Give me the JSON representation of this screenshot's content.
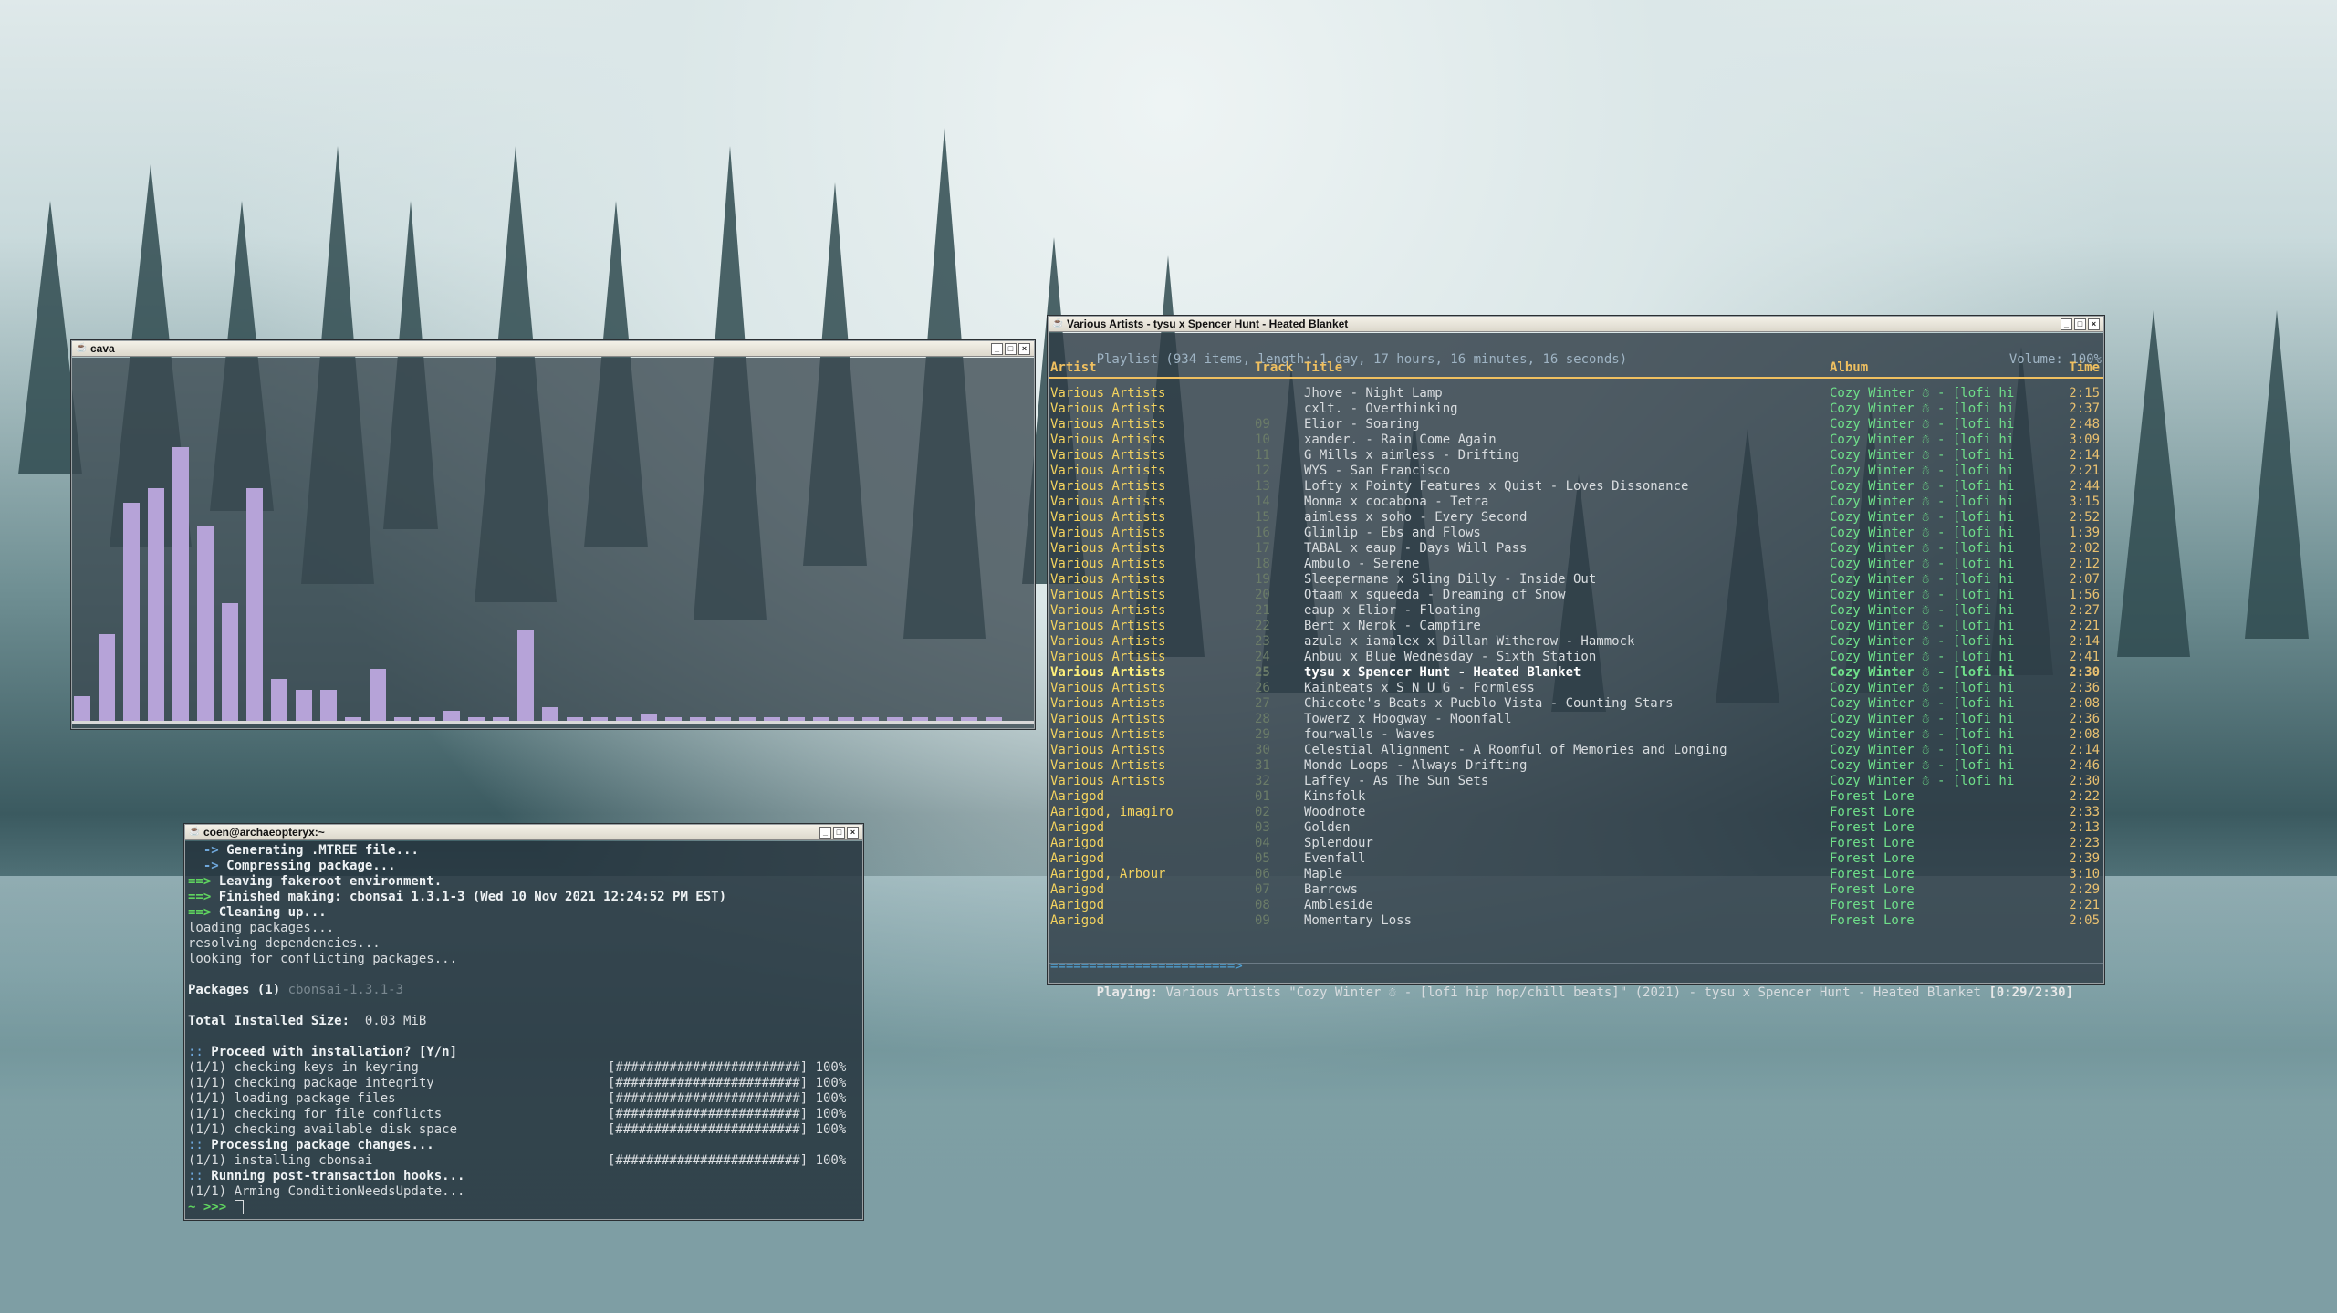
{
  "cava": {
    "title": "cava",
    "bar_levels": [
      0.07,
      0.25,
      0.63,
      0.67,
      0.79,
      0.56,
      0.34,
      0.67,
      0.12,
      0.09,
      0.09,
      0.01,
      0.15,
      0.01,
      0.01,
      0.03,
      0.01,
      0.01,
      0.26,
      0.04,
      0.01,
      0.01,
      0.01,
      0.02,
      0.01,
      0.01,
      0.01,
      0.01,
      0.01,
      0.01,
      0.01,
      0.01,
      0.01,
      0.01,
      0.01,
      0.01,
      0.01,
      0.01
    ],
    "bar_color": "#b6a3d8"
  },
  "terminal": {
    "title": "coen@archaeopteryx:~",
    "lines": [
      {
        "type": "arrow2",
        "text": "Generating .MTREE file..."
      },
      {
        "type": "arrow2",
        "text": "Compressing package..."
      },
      {
        "type": "green",
        "text": "Leaving fakeroot environment."
      },
      {
        "type": "green",
        "text": "Finished making: cbonsai 1.3.1-3 (Wed 10 Nov 2021 12:24:52 PM EST)"
      },
      {
        "type": "green",
        "text": "Cleaning up..."
      },
      {
        "type": "plain",
        "text": "loading packages..."
      },
      {
        "type": "plain",
        "text": "resolving dependencies..."
      },
      {
        "type": "plain",
        "text": "looking for conflicting packages..."
      },
      {
        "type": "blank",
        "text": ""
      },
      {
        "type": "pkgs",
        "text": "Packages (1) ",
        "extra": "cbonsai-1.3.1-3"
      },
      {
        "type": "blank",
        "text": ""
      },
      {
        "type": "size",
        "text": "Total Installed Size:  ",
        "extra": "0.03 MiB"
      },
      {
        "type": "blank",
        "text": ""
      },
      {
        "type": "colon",
        "text": "Proceed with installation? [Y/n]"
      },
      {
        "type": "progress",
        "text": "(1/1) checking keys in keyring",
        "bar": "[########################] 100%"
      },
      {
        "type": "progress",
        "text": "(1/1) checking package integrity",
        "bar": "[########################] 100%"
      },
      {
        "type": "progress",
        "text": "(1/1) loading package files",
        "bar": "[########################] 100%"
      },
      {
        "type": "progress",
        "text": "(1/1) checking for file conflicts",
        "bar": "[########################] 100%"
      },
      {
        "type": "progress",
        "text": "(1/1) checking available disk space",
        "bar": "[########################] 100%"
      },
      {
        "type": "colon",
        "text": "Processing package changes..."
      },
      {
        "type": "progress",
        "text": "(1/1) installing cbonsai",
        "bar": "[########################] 100%"
      },
      {
        "type": "colon",
        "text": "Running post-transaction hooks..."
      },
      {
        "type": "plain",
        "text": "(1/1) Arming ConditionNeedsUpdate..."
      },
      {
        "type": "prompt",
        "text": "~ >>> "
      }
    ]
  },
  "player": {
    "title": "Various Artists - tysu x Spencer Hunt - Heated Blanket",
    "playlist_info": "Playlist (934 items, length: 1 day, 17 hours, 16 minutes, 16 seconds)",
    "volume": "Volume: 100%",
    "columns": {
      "artist": "Artist",
      "track": "Track",
      "title": "Title",
      "album": "Album",
      "time": "Time"
    },
    "rows": [
      {
        "artist": "Various Artists",
        "track": "",
        "title": "Jhove - Night Lamp",
        "album": "Cozy Winter ☃ - [lofi hi",
        "time": "2:15"
      },
      {
        "artist": "Various Artists",
        "track": "",
        "title": "cxlt. - Overthinking",
        "album": "Cozy Winter ☃ - [lofi hi",
        "time": "2:37"
      },
      {
        "artist": "Various Artists",
        "track": "09",
        "title": "Elior - Soaring",
        "album": "Cozy Winter ☃ - [lofi hi",
        "time": "2:48"
      },
      {
        "artist": "Various Artists",
        "track": "10",
        "title": "xander. - Rain Come Again",
        "album": "Cozy Winter ☃ - [lofi hi",
        "time": "3:09"
      },
      {
        "artist": "Various Artists",
        "track": "11",
        "title": "G Mills x aimless - Drifting",
        "album": "Cozy Winter ☃ - [lofi hi",
        "time": "2:14"
      },
      {
        "artist": "Various Artists",
        "track": "12",
        "title": "WYS - San Francisco",
        "album": "Cozy Winter ☃ - [lofi hi",
        "time": "2:21"
      },
      {
        "artist": "Various Artists",
        "track": "13",
        "title": "Lofty x Pointy Features x Quist - Loves Dissonance",
        "album": "Cozy Winter ☃ - [lofi hi",
        "time": "2:44"
      },
      {
        "artist": "Various Artists",
        "track": "14",
        "title": "Monma x cocabona - Tetra",
        "album": "Cozy Winter ☃ - [lofi hi",
        "time": "3:15"
      },
      {
        "artist": "Various Artists",
        "track": "15",
        "title": "aimless x soho - Every Second",
        "album": "Cozy Winter ☃ - [lofi hi",
        "time": "2:52"
      },
      {
        "artist": "Various Artists",
        "track": "16",
        "title": "Glimlip - Ebs and Flows",
        "album": "Cozy Winter ☃ - [lofi hi",
        "time": "1:39"
      },
      {
        "artist": "Various Artists",
        "track": "17",
        "title": "TABAL x eaup - Days Will Pass",
        "album": "Cozy Winter ☃ - [lofi hi",
        "time": "2:02"
      },
      {
        "artist": "Various Artists",
        "track": "18",
        "title": "Ambulo - Serene",
        "album": "Cozy Winter ☃ - [lofi hi",
        "time": "2:12"
      },
      {
        "artist": "Various Artists",
        "track": "19",
        "title": "Sleepermane x Sling Dilly - Inside Out",
        "album": "Cozy Winter ☃ - [lofi hi",
        "time": "2:07"
      },
      {
        "artist": "Various Artists",
        "track": "20",
        "title": "Otaam x squeeda - Dreaming of Snow",
        "album": "Cozy Winter ☃ - [lofi hi",
        "time": "1:56"
      },
      {
        "artist": "Various Artists",
        "track": "21",
        "title": "eaup x Elior - Floating",
        "album": "Cozy Winter ☃ - [lofi hi",
        "time": "2:27"
      },
      {
        "artist": "Various Artists",
        "track": "22",
        "title": "Bert x Nerok - Campfire",
        "album": "Cozy Winter ☃ - [lofi hi",
        "time": "2:21"
      },
      {
        "artist": "Various Artists",
        "track": "23",
        "title": "azula x iamalex x Dillan Witherow - Hammock",
        "album": "Cozy Winter ☃ - [lofi hi",
        "time": "2:14"
      },
      {
        "artist": "Various Artists",
        "track": "24",
        "title": "Anbuu x Blue Wednesday - Sixth Station",
        "album": "Cozy Winter ☃ - [lofi hi",
        "time": "2:41"
      },
      {
        "artist": "Various Artists",
        "track": "25",
        "title": "tysu x Spencer Hunt - Heated Blanket",
        "album": "Cozy Winter ☃ - [lofi hi",
        "time": "2:30",
        "current": true
      },
      {
        "artist": "Various Artists",
        "track": "26",
        "title": "Kainbeats x S N U G - Formless",
        "album": "Cozy Winter ☃ - [lofi hi",
        "time": "2:36"
      },
      {
        "artist": "Various Artists",
        "track": "27",
        "title": "Chiccote's Beats x Pueblo Vista - Counting Stars",
        "album": "Cozy Winter ☃ - [lofi hi",
        "time": "2:08"
      },
      {
        "artist": "Various Artists",
        "track": "28",
        "title": "Towerz x Hoogway - Moonfall",
        "album": "Cozy Winter ☃ - [lofi hi",
        "time": "2:36"
      },
      {
        "artist": "Various Artists",
        "track": "29",
        "title": "fourwalls - Waves",
        "album": "Cozy Winter ☃ - [lofi hi",
        "time": "2:08"
      },
      {
        "artist": "Various Artists",
        "track": "30",
        "title": "Celestial Alignment - A Roomful of Memories and Longing",
        "album": "Cozy Winter ☃ - [lofi hi",
        "time": "2:14"
      },
      {
        "artist": "Various Artists",
        "track": "31",
        "title": "Mondo Loops - Always Drifting",
        "album": "Cozy Winter ☃ - [lofi hi",
        "time": "2:46"
      },
      {
        "artist": "Various Artists",
        "track": "32",
        "title": "Laffey - As The Sun Sets",
        "album": "Cozy Winter ☃ - [lofi hi",
        "time": "2:30"
      },
      {
        "artist": "Aarigod",
        "track": "01",
        "title": "Kinsfolk",
        "album": "Forest Lore",
        "time": "2:22"
      },
      {
        "artist": "Aarigod, imagiro",
        "track": "02",
        "title": "Woodnote",
        "album": "Forest Lore",
        "time": "2:33"
      },
      {
        "artist": "Aarigod",
        "track": "03",
        "title": "Golden",
        "album": "Forest Lore",
        "time": "2:13"
      },
      {
        "artist": "Aarigod",
        "track": "04",
        "title": "Splendour",
        "album": "Forest Lore",
        "time": "2:23"
      },
      {
        "artist": "Aarigod",
        "track": "05",
        "title": "Evenfall",
        "album": "Forest Lore",
        "time": "2:39"
      },
      {
        "artist": "Aarigod, Arbour",
        "track": "06",
        "title": "Maple",
        "album": "Forest Lore",
        "time": "3:10"
      },
      {
        "artist": "Aarigod",
        "track": "07",
        "title": "Barrows",
        "album": "Forest Lore",
        "time": "2:29"
      },
      {
        "artist": "Aarigod",
        "track": "08",
        "title": "Ambleside",
        "album": "Forest Lore",
        "time": "2:21"
      },
      {
        "artist": "Aarigod",
        "track": "09",
        "title": "Momentary Loss",
        "album": "Forest Lore",
        "time": "2:05"
      }
    ],
    "progress_bar": "========================>",
    "status_label": "Playing:",
    "status_text": " Various Artists \"Cozy Winter ☃ - [lofi hip hop/chill beats]\" (2021) - tysu x Spencer Hunt - Heated Blanket ",
    "status_time": "[0:29/2:30]",
    "progress_fraction": 0.19
  }
}
